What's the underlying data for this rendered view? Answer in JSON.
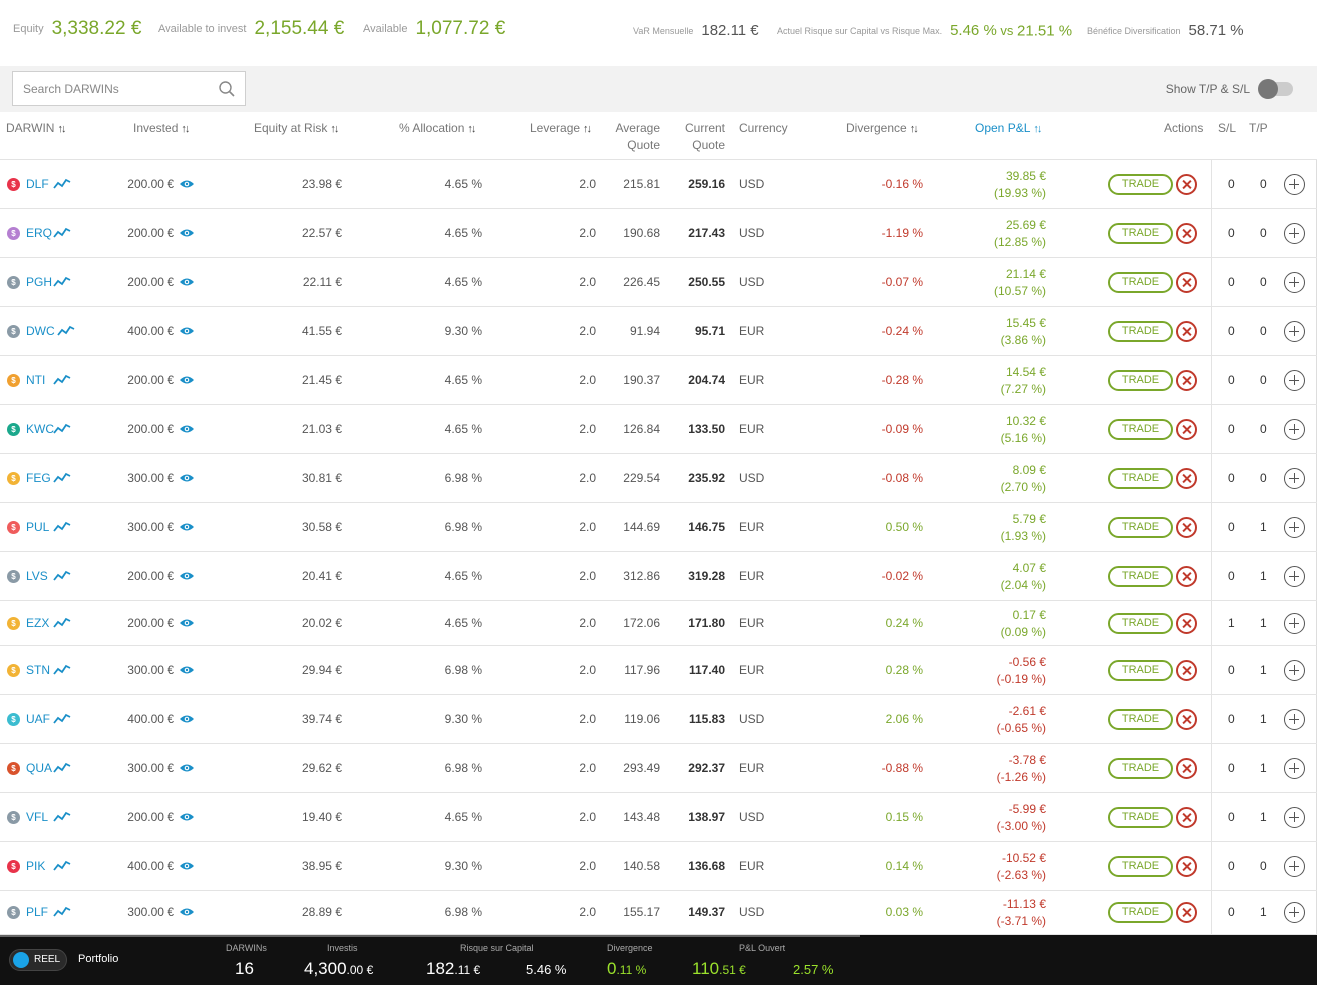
{
  "summary": {
    "equity_label": "Equity",
    "equity_value": "3,338.22 €",
    "avail_invest_label": "Available to invest",
    "avail_invest_value": "2,155.44 €",
    "available_label": "Available",
    "available_value": "1,077.72 €",
    "var_label": "VaR Mensuelle",
    "var_value": "182.11 €",
    "risk_label": "Actuel Risque sur Capital vs Risque Max.",
    "risk_value": "5.46 %",
    "risk_vs": " vs ",
    "risk_max": "21.51 %",
    "div_label": "Bénéfice Diversification",
    "div_value": "58.71 %"
  },
  "toolbar": {
    "search_placeholder": "Search DARWINs",
    "show_tpsl_label": "Show T/P & S/L"
  },
  "columns": {
    "darwin": "DARWIN",
    "invested": "Invested",
    "equity_at_risk": "Equity at Risk",
    "allocation": "% Allocation",
    "leverage": "Leverage",
    "avg_quote_1": "Average",
    "avg_quote_2": "Quote",
    "cur_quote_1": "Current",
    "cur_quote_2": "Quote",
    "currency": "Currency",
    "divergence": "Divergence",
    "open_pnl": "Open P&L",
    "actions": "Actions",
    "sl": "S/L",
    "tp": "T/P",
    "sort_glyph": "↑↓"
  },
  "trade_label": "TRADE",
  "rows": [
    {
      "badge": "$",
      "badge_color": "#e8334a",
      "name": "DLF",
      "invested": "200.00 €",
      "ear": "23.98 €",
      "alloc": "4.65 %",
      "lev": "2.0",
      "avg": "215.81",
      "cur": "259.16",
      "ccy": "USD",
      "div": "-0.16 %",
      "div_sign": "neg",
      "pnl": "39.85 €",
      "pnl_pct": "(19.93 %)",
      "pnl_sign": "pos",
      "sl": "0",
      "tp": "0"
    },
    {
      "badge": "$",
      "badge_color": "#b57fd1",
      "name": "ERQ",
      "invested": "200.00 €",
      "ear": "22.57 €",
      "alloc": "4.65 %",
      "lev": "2.0",
      "avg": "190.68",
      "cur": "217.43",
      "ccy": "USD",
      "div": "-1.19 %",
      "div_sign": "neg",
      "pnl": "25.69 €",
      "pnl_pct": "(12.85 %)",
      "pnl_sign": "pos",
      "sl": "0",
      "tp": "0"
    },
    {
      "badge": "$",
      "badge_color": "#8a9aa6",
      "name": "PGH",
      "invested": "200.00 €",
      "ear": "22.11 €",
      "alloc": "4.65 %",
      "lev": "2.0",
      "avg": "226.45",
      "cur": "250.55",
      "ccy": "USD",
      "div": "-0.07 %",
      "div_sign": "neg",
      "pnl": "21.14 €",
      "pnl_pct": "(10.57 %)",
      "pnl_sign": "pos",
      "sl": "0",
      "tp": "0"
    },
    {
      "badge": "$",
      "badge_color": "#8a9aa6",
      "name": "DWC",
      "invested": "400.00 €",
      "ear": "41.55 €",
      "alloc": "9.30 %",
      "lev": "2.0",
      "avg": "91.94",
      "cur": "95.71",
      "ccy": "EUR",
      "div": "-0.24 %",
      "div_sign": "neg",
      "pnl": "15.45 €",
      "pnl_pct": "(3.86 %)",
      "pnl_sign": "pos",
      "sl": "0",
      "tp": "0"
    },
    {
      "badge": "$",
      "badge_color": "#f0a030",
      "name": "NTI",
      "invested": "200.00 €",
      "ear": "21.45 €",
      "alloc": "4.65 %",
      "lev": "2.0",
      "avg": "190.37",
      "cur": "204.74",
      "ccy": "EUR",
      "div": "-0.28 %",
      "div_sign": "neg",
      "pnl": "14.54 €",
      "pnl_pct": "(7.27 %)",
      "pnl_sign": "pos",
      "sl": "0",
      "tp": "0"
    },
    {
      "badge": "$",
      "badge_color": "#1ba88c",
      "name": "KWC",
      "invested": "200.00 €",
      "ear": "21.03 €",
      "alloc": "4.65 %",
      "lev": "2.0",
      "avg": "126.84",
      "cur": "133.50",
      "ccy": "EUR",
      "div": "-0.09 %",
      "div_sign": "neg",
      "pnl": "10.32 €",
      "pnl_pct": "(5.16 %)",
      "pnl_sign": "pos",
      "sl": "0",
      "tp": "0"
    },
    {
      "badge": "$",
      "badge_color": "#f2b335",
      "name": "FEG",
      "invested": "300.00 €",
      "ear": "30.81 €",
      "alloc": "6.98 %",
      "lev": "2.0",
      "avg": "229.54",
      "cur": "235.92",
      "ccy": "USD",
      "div": "-0.08 %",
      "div_sign": "neg",
      "pnl": "8.09 €",
      "pnl_pct": "(2.70 %)",
      "pnl_sign": "pos",
      "sl": "0",
      "tp": "0"
    },
    {
      "badge": "$",
      "badge_color": "#ef5c5c",
      "name": "PUL",
      "invested": "300.00 €",
      "ear": "30.58 €",
      "alloc": "6.98 %",
      "lev": "2.0",
      "avg": "144.69",
      "cur": "146.75",
      "ccy": "EUR",
      "div": "0.50 %",
      "div_sign": "pos",
      "pnl": "5.79 €",
      "pnl_pct": "(1.93 %)",
      "pnl_sign": "pos",
      "sl": "0",
      "tp": "1"
    },
    {
      "badge": "$",
      "badge_color": "#8a9aa6",
      "name": "LVS",
      "invested": "200.00 €",
      "ear": "20.41 €",
      "alloc": "4.65 %",
      "lev": "2.0",
      "avg": "312.86",
      "cur": "319.28",
      "ccy": "EUR",
      "div": "-0.02 %",
      "div_sign": "neg",
      "pnl": "4.07 €",
      "pnl_pct": "(2.04 %)",
      "pnl_sign": "pos",
      "sl": "0",
      "tp": "1"
    },
    {
      "badge": "$",
      "badge_color": "#f2b335",
      "name": "EZX",
      "invested": "200.00 €",
      "ear": "20.02 €",
      "alloc": "4.65 %",
      "lev": "2.0",
      "avg": "172.06",
      "cur": "171.80",
      "ccy": "EUR",
      "div": "0.24 %",
      "div_sign": "pos",
      "pnl": "0.17 €",
      "pnl_pct": "(0.09 %)",
      "pnl_sign": "pos",
      "sl": "1",
      "tp": "1"
    },
    {
      "badge": "$",
      "badge_color": "#f2b335",
      "name": "STN",
      "invested": "300.00 €",
      "ear": "29.94 €",
      "alloc": "6.98 %",
      "lev": "2.0",
      "avg": "117.96",
      "cur": "117.40",
      "ccy": "EUR",
      "div": "0.28 %",
      "div_sign": "pos",
      "pnl": "-0.56 €",
      "pnl_pct": "(-0.19 %)",
      "pnl_sign": "neg",
      "sl": "0",
      "tp": "1"
    },
    {
      "badge": "$",
      "badge_color": "#3bbcd0",
      "name": "UAF",
      "invested": "400.00 €",
      "ear": "39.74 €",
      "alloc": "9.30 %",
      "lev": "2.0",
      "avg": "119.06",
      "cur": "115.83",
      "ccy": "USD",
      "div": "2.06 %",
      "div_sign": "pos",
      "pnl": "-2.61 €",
      "pnl_pct": "(-0.65 %)",
      "pnl_sign": "neg",
      "sl": "0",
      "tp": "1"
    },
    {
      "badge": "$",
      "badge_color": "#d9532c",
      "name": "QUA",
      "invested": "300.00 €",
      "ear": "29.62 €",
      "alloc": "6.98 %",
      "lev": "2.0",
      "avg": "293.49",
      "cur": "292.37",
      "ccy": "EUR",
      "div": "-0.88 %",
      "div_sign": "neg",
      "pnl": "-3.78 €",
      "pnl_pct": "(-1.26 %)",
      "pnl_sign": "neg",
      "sl": "0",
      "tp": "1"
    },
    {
      "badge": "$",
      "badge_color": "#8a9aa6",
      "name": "VFL",
      "invested": "200.00 €",
      "ear": "19.40 €",
      "alloc": "4.65 %",
      "lev": "2.0",
      "avg": "143.48",
      "cur": "138.97",
      "ccy": "USD",
      "div": "0.15 %",
      "div_sign": "pos",
      "pnl": "-5.99 €",
      "pnl_pct": "(-3.00 %)",
      "pnl_sign": "neg",
      "sl": "0",
      "tp": "1"
    },
    {
      "badge": "$",
      "badge_color": "#e8334a",
      "name": "PIK",
      "invested": "400.00 €",
      "ear": "38.95 €",
      "alloc": "9.30 %",
      "lev": "2.0",
      "avg": "140.58",
      "cur": "136.68",
      "ccy": "EUR",
      "div": "0.14 %",
      "div_sign": "pos",
      "pnl": "-10.52 €",
      "pnl_pct": "(-2.63 %)",
      "pnl_sign": "neg",
      "sl": "0",
      "tp": "0"
    },
    {
      "badge": "$",
      "badge_color": "#8a9aa6",
      "name": "PLF",
      "invested": "300.00 €",
      "ear": "28.89 €",
      "alloc": "6.98 %",
      "lev": "2.0",
      "avg": "155.17",
      "cur": "149.37",
      "ccy": "USD",
      "div": "0.03 %",
      "div_sign": "pos",
      "pnl": "-11.13 €",
      "pnl_pct": "(-3.71 %)",
      "pnl_sign": "neg",
      "sl": "0",
      "tp": "1"
    }
  ],
  "footer": {
    "mode_label": "REEL",
    "portfolio_label": "Portfolio",
    "darwins_label": "DARWINs",
    "darwins_value": "16",
    "investis_label": "Investis",
    "investis_main": "4,300",
    "investis_dec": ".00 €",
    "risk_label": "Risque sur Capital",
    "risk_main": "182",
    "risk_dec": ".11 €",
    "risk_pct": "5.46 %",
    "div_label": "Divergence",
    "div_main": "0",
    "div_dec": ".11 %",
    "pnl_label": "P&L Ouvert",
    "pnl_main": "110",
    "pnl_dec": ".51 €",
    "pnl_pct": "2.57 %"
  }
}
